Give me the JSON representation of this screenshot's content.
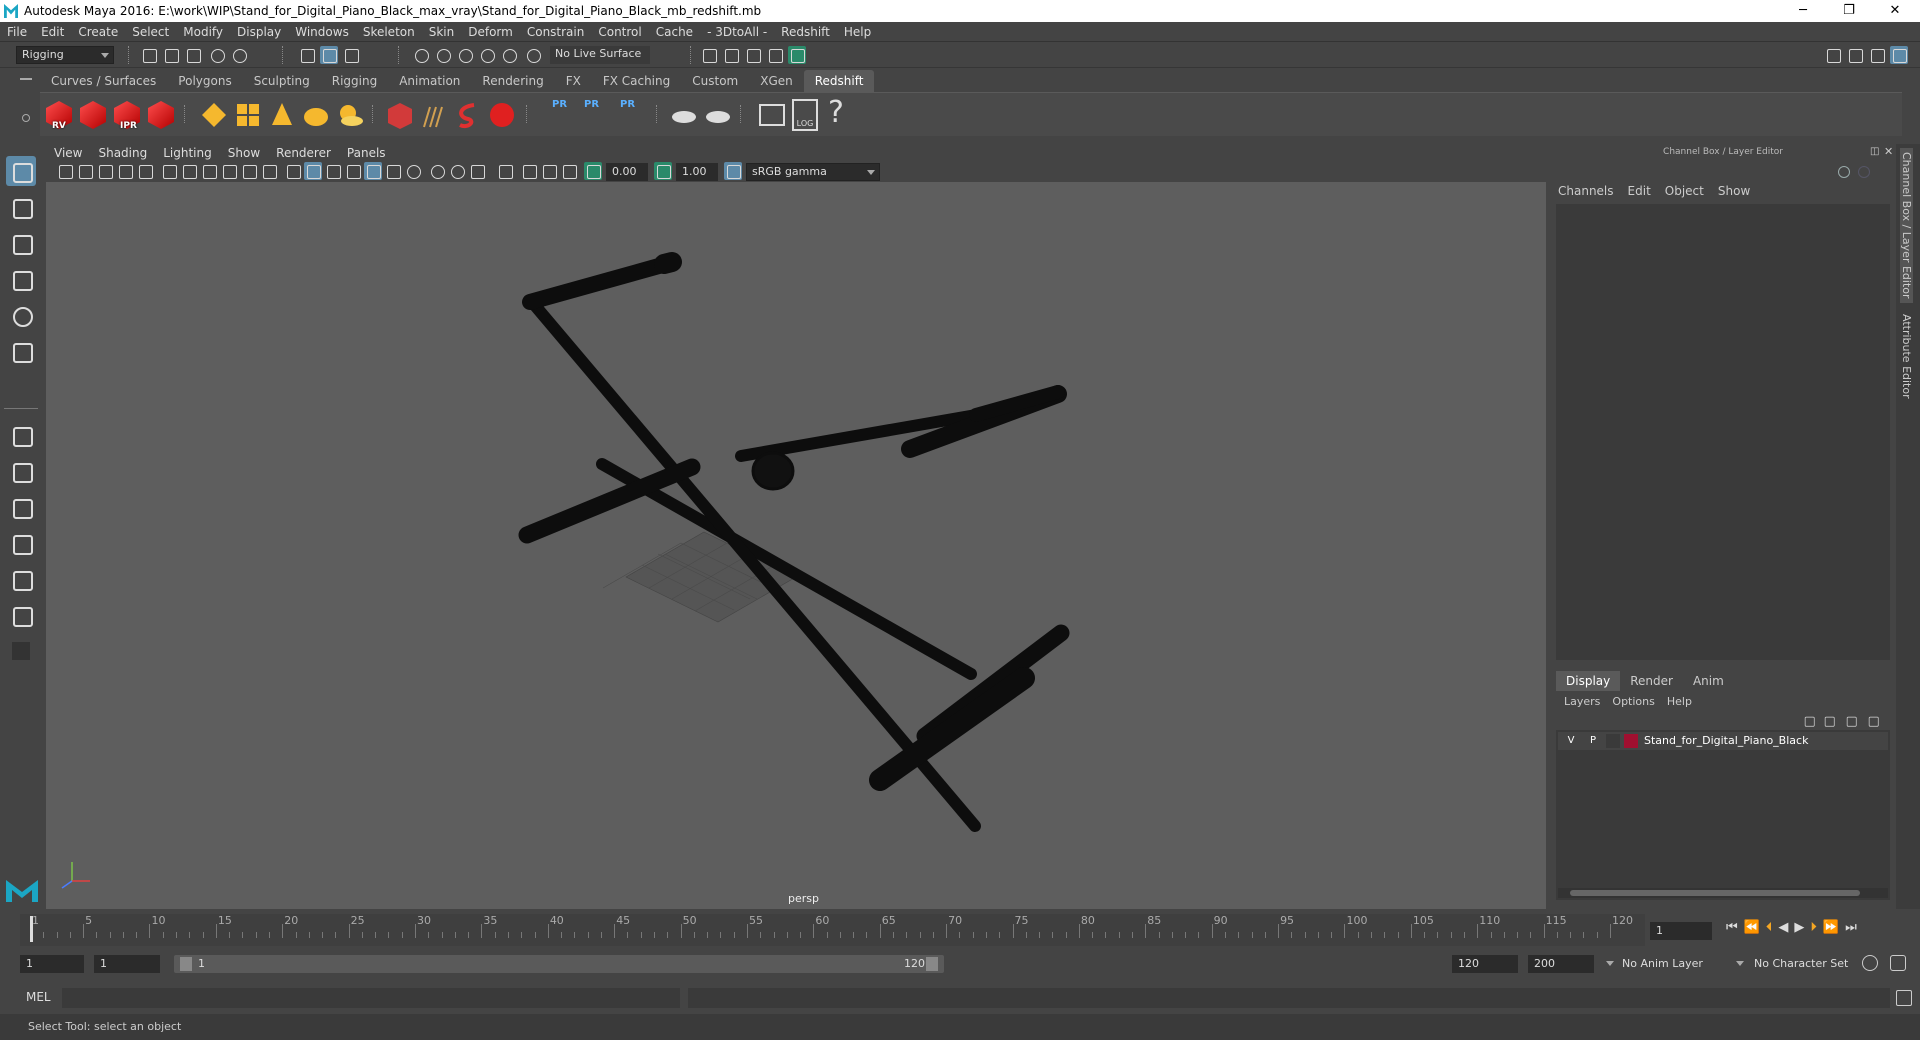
{
  "window": {
    "title": "Autodesk Maya 2016: E:\\work\\WIP\\Stand_for_Digital_Piano_Black_max_vray\\Stand_for_Digital_Piano_Black_mb_redshift.mb",
    "minimize": "─",
    "restore": "❐",
    "close": "✕"
  },
  "menubar": [
    "File",
    "Edit",
    "Create",
    "Select",
    "Modify",
    "Display",
    "Windows",
    "Skeleton",
    "Skin",
    "Deform",
    "Constrain",
    "Control",
    "Cache",
    "- 3DtoAll -",
    "Redshift",
    "Help"
  ],
  "statusline": {
    "mode": "Rigging",
    "live_surface": "No Live Surface"
  },
  "shelf": {
    "tabs": [
      "Curves / Surfaces",
      "Polygons",
      "Sculpting",
      "Rigging",
      "Animation",
      "Rendering",
      "FX",
      "FX Caching",
      "Custom",
      "XGen",
      "Redshift"
    ],
    "active_tab": "Redshift",
    "cube_labels": [
      "RV",
      "",
      "IPR",
      ""
    ],
    "pr_labels": [
      "PR",
      "PR",
      "PR"
    ],
    "log_label": "LOG",
    "help_glyph": "?"
  },
  "viewport": {
    "menu": [
      "View",
      "Shading",
      "Lighting",
      "Show",
      "Renderer",
      "Panels"
    ],
    "exposure": "0.00",
    "gamma": "1.00",
    "colorspace": "sRGB gamma",
    "camera": "persp"
  },
  "channelbox": {
    "title": "Channel Box / Layer Editor",
    "menu": [
      "Channels",
      "Edit",
      "Object",
      "Show"
    ]
  },
  "layereditor": {
    "tabs": [
      "Display",
      "Render",
      "Anim"
    ],
    "menu": [
      "Layers",
      "Options",
      "Help"
    ],
    "layer": {
      "v": "V",
      "p": "P",
      "name": "Stand_for_Digital_Piano_Black",
      "color": "#a01030"
    }
  },
  "sidetabs": {
    "channel": "Channel Box / Layer Editor",
    "attribute": "Attribute Editor"
  },
  "timeline": {
    "ticks": [
      "1",
      "5",
      "10",
      "15",
      "20",
      "25",
      "30",
      "35",
      "40",
      "45",
      "50",
      "55",
      "60",
      "65",
      "70",
      "75",
      "80",
      "85",
      "90",
      "95",
      "100",
      "105",
      "110",
      "115",
      "120"
    ],
    "current_frame": "1"
  },
  "range": {
    "start": "1",
    "playback_start": "1",
    "slider_start": "1",
    "slider_end": "120",
    "playback_end": "120",
    "end": "200",
    "anim_layer": "No Anim Layer",
    "character_set": "No Character Set"
  },
  "cmdline": {
    "lang": "MEL"
  },
  "helpline": {
    "text": "Select Tool: select an object"
  }
}
